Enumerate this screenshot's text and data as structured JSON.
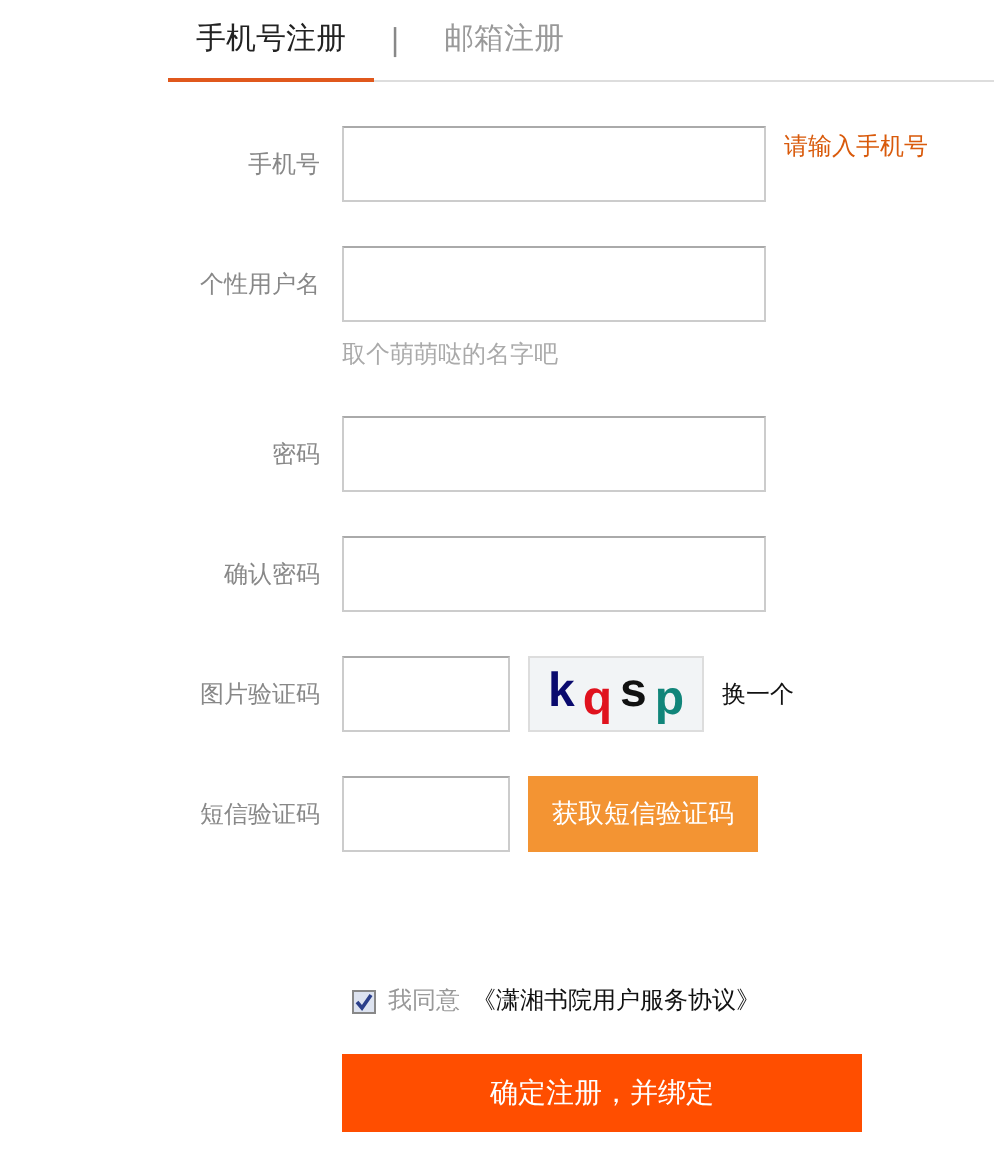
{
  "tabs": [
    {
      "label": "手机号注册",
      "selected": true
    },
    {
      "label": "邮箱注册",
      "selected": false
    }
  ],
  "tab_separator": "|",
  "fields": [
    {
      "kind": "text",
      "label": "手机号",
      "error": "请输入手机号"
    },
    {
      "kind": "text",
      "label": "个性用户名",
      "hint": "取个萌萌哒的名字吧"
    },
    {
      "kind": "text",
      "label": "密码"
    },
    {
      "kind": "text",
      "label": "确认密码"
    },
    {
      "kind": "captcha",
      "label": "图片验证码",
      "captcha": [
        {
          "char": "k",
          "color": "#0a0a6e"
        },
        {
          "char": "q",
          "color": "#e0121e"
        },
        {
          "char": "s",
          "color": "#111111"
        },
        {
          "char": "p",
          "color": "#11857a"
        }
      ],
      "refresh": "换一个"
    },
    {
      "kind": "sms",
      "label": "短信验证码",
      "button": "获取短信验证码"
    }
  ],
  "agreement": {
    "checked": true,
    "text": "我同意",
    "link": "《潇湘书院用户服务协议》"
  },
  "submit": "确定注册，并绑定"
}
